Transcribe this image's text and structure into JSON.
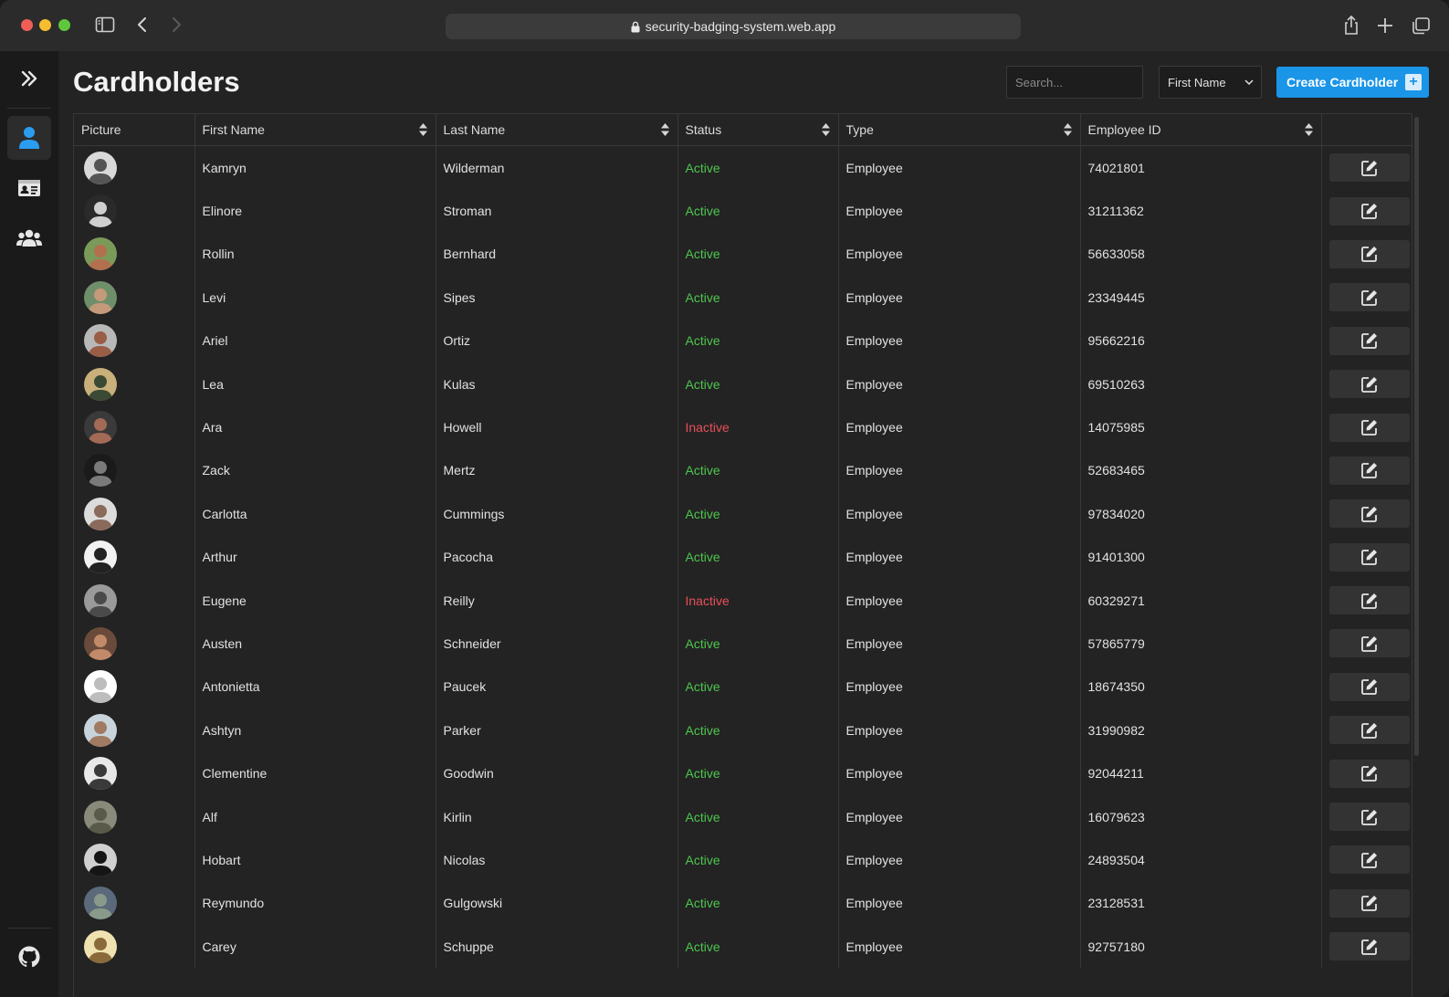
{
  "browser": {
    "url": "security-badging-system.web.app"
  },
  "sidebar": {
    "items": [
      {
        "icon": "chevrons-right-icon"
      },
      {
        "icon": "user-icon",
        "active": true
      },
      {
        "icon": "id-card-icon"
      },
      {
        "icon": "users-group-icon"
      },
      {
        "icon": "github-icon"
      }
    ]
  },
  "header": {
    "title": "Cardholders",
    "search_placeholder": "Search...",
    "sort_select": "First Name",
    "create_label": "Create Cardholder"
  },
  "colors": {
    "accent": "#1a95e8",
    "active": "#4ec64e",
    "inactive": "#e8505b"
  },
  "table": {
    "columns": [
      "Picture",
      "First Name",
      "Last Name",
      "Status",
      "Type",
      "Employee ID"
    ],
    "rows": [
      {
        "first": "Kamryn",
        "last": "Wilderman",
        "status": "Active",
        "type": "Employee",
        "id": "74021801",
        "avatar": [
          "#d9d9d9",
          "#555555"
        ]
      },
      {
        "first": "Elinore",
        "last": "Stroman",
        "status": "Active",
        "type": "Employee",
        "id": "31211362",
        "avatar": [
          "#2a2a2a",
          "#cfcfcf"
        ]
      },
      {
        "first": "Rollin",
        "last": "Bernhard",
        "status": "Active",
        "type": "Employee",
        "id": "56633058",
        "avatar": [
          "#7a9a5a",
          "#b3704f"
        ]
      },
      {
        "first": "Levi",
        "last": "Sipes",
        "status": "Active",
        "type": "Employee",
        "id": "23349445",
        "avatar": [
          "#6f8f6a",
          "#c49a7a"
        ]
      },
      {
        "first": "Ariel",
        "last": "Ortiz",
        "status": "Active",
        "type": "Employee",
        "id": "95662216",
        "avatar": [
          "#b8b8b8",
          "#9a5d45"
        ]
      },
      {
        "first": "Lea",
        "last": "Kulas",
        "status": "Active",
        "type": "Employee",
        "id": "69510263",
        "avatar": [
          "#c9b07a",
          "#3b4a35"
        ]
      },
      {
        "first": "Ara",
        "last": "Howell",
        "status": "Inactive",
        "type": "Employee",
        "id": "14075985",
        "avatar": [
          "#3a3a3a",
          "#a36a55"
        ]
      },
      {
        "first": "Zack",
        "last": "Mertz",
        "status": "Active",
        "type": "Employee",
        "id": "52683465",
        "avatar": [
          "#1a1a1a",
          "#7a7a7a"
        ]
      },
      {
        "first": "Carlotta",
        "last": "Cummings",
        "status": "Active",
        "type": "Employee",
        "id": "97834020",
        "avatar": [
          "#dcdcdc",
          "#8a6a5a"
        ]
      },
      {
        "first": "Arthur",
        "last": "Pacocha",
        "status": "Active",
        "type": "Employee",
        "id": "91401300",
        "avatar": [
          "#f2f2f2",
          "#222222"
        ]
      },
      {
        "first": "Eugene",
        "last": "Reilly",
        "status": "Inactive",
        "type": "Employee",
        "id": "60329271",
        "avatar": [
          "#9a9a9a",
          "#4a4a4a"
        ]
      },
      {
        "first": "Austen",
        "last": "Schneider",
        "status": "Active",
        "type": "Employee",
        "id": "57865779",
        "avatar": [
          "#6a4a3a",
          "#c28a6a"
        ]
      },
      {
        "first": "Antonietta",
        "last": "Paucek",
        "status": "Active",
        "type": "Employee",
        "id": "18674350",
        "avatar": [
          "#ffffff",
          "#bdbdbd"
        ]
      },
      {
        "first": "Ashtyn",
        "last": "Parker",
        "status": "Active",
        "type": "Employee",
        "id": "31990982",
        "avatar": [
          "#c8d4dc",
          "#a07a62"
        ]
      },
      {
        "first": "Clementine",
        "last": "Goodwin",
        "status": "Active",
        "type": "Employee",
        "id": "92044211",
        "avatar": [
          "#e8e8e8",
          "#3a3a3a"
        ]
      },
      {
        "first": "Alf",
        "last": "Kirlin",
        "status": "Active",
        "type": "Employee",
        "id": "16079623",
        "avatar": [
          "#8a8a7a",
          "#5a5a4a"
        ]
      },
      {
        "first": "Hobart",
        "last": "Nicolas",
        "status": "Active",
        "type": "Employee",
        "id": "24893504",
        "avatar": [
          "#d0d0d0",
          "#151515"
        ]
      },
      {
        "first": "Reymundo",
        "last": "Gulgowski",
        "status": "Active",
        "type": "Employee",
        "id": "23128531",
        "avatar": [
          "#5a6a7a",
          "#8a9a8a"
        ]
      },
      {
        "first": "Carey",
        "last": "Schuppe",
        "status": "Active",
        "type": "Employee",
        "id": "92757180",
        "avatar": [
          "#f0e2b0",
          "#8a6a3a"
        ]
      }
    ]
  }
}
